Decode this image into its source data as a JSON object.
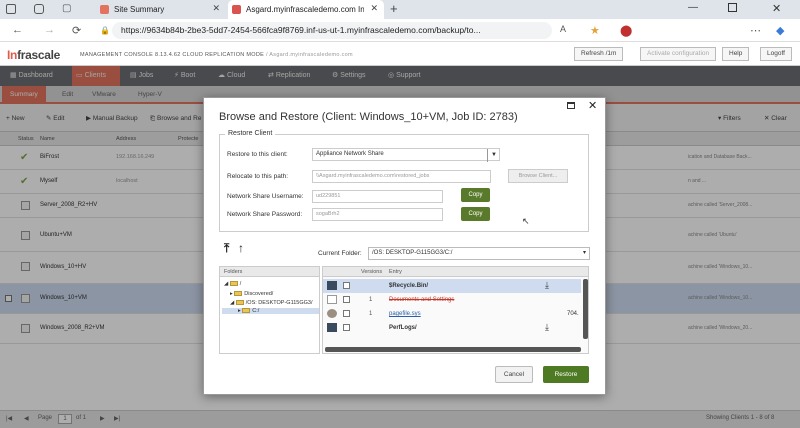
{
  "browser": {
    "tabs": [
      {
        "title": "Site Summary"
      },
      {
        "title": "Asgard.myinfrascalede​mo.com Inf..."
      }
    ],
    "url": "https://9634b84b-2be3-5dd7-2454-566fca9f8769.inf-us-ut-1.myinfrascaledemo.com/backup/to..."
  },
  "app": {
    "logo_prefix": "In",
    "logo_text": "frascale",
    "console_text": "MANAGEMENT CONSOLE 8.13.4.62 CLOUD REPLICATION MODE",
    "site_text": "/ Asgard.myinfrascaledemo.com",
    "header_buttons": {
      "refresh": "Refresh /1m",
      "activate": "Activate configuration",
      "help": "Help",
      "logoff": "Logoff"
    },
    "nav": [
      "Dashboard",
      "Clients",
      "Jobs",
      "Boot",
      "Cloud",
      "Replication",
      "Settings",
      "Support"
    ],
    "subnav": [
      "Summary",
      "Edit",
      "VMware",
      "Hyper-V"
    ],
    "toolbar": {
      "new": "New",
      "edit": "Edit",
      "manual_backup": "Manual Backup",
      "browse_restore": "Browse and Re",
      "filters": "Filters",
      "clear": "Clear"
    },
    "columns": {
      "status": "Status",
      "name": "Name",
      "address": "Address",
      "protected": "Protecte"
    },
    "rows": [
      {
        "name": "BiFrost",
        "address": "192.168.16.249",
        "desc": "ication and Database Back..."
      },
      {
        "name": "Myself",
        "address": "localhost",
        "desc": "n and ..."
      },
      {
        "name": "Server_2008_R2+HV",
        "address": "",
        "desc": "achine called 'Server_2008..."
      },
      {
        "name": "Ubuntu+VM",
        "address": "",
        "desc": "achine called 'Ubuntu'"
      },
      {
        "name": "Windows_10+HV",
        "address": "",
        "desc": "achine called 'Windows_10..."
      },
      {
        "name": "Windows_10+VM",
        "address": "",
        "desc": "achine called 'Windows_10..."
      },
      {
        "name": "Windows_2008_R2+VM",
        "address": "",
        "desc": "achine called 'Windows_20..."
      }
    ],
    "pager": {
      "page_label": "Page",
      "page_value": "1",
      "of_text": "of 1",
      "showing": "Showing Clients 1 - 8 of 8"
    }
  },
  "dialog": {
    "title": "Browse and Restore (Client: Windows_10+VM, Job ID: 2783)",
    "legend": "Restore Client",
    "restore_to_label": "Restore to this client:",
    "restore_to_value": "Appliance Network Share",
    "relocate_label": "Relocate to this path:",
    "relocate_value": "\\\\Asgard.myinfrascaledemo.com\\restored_jobs",
    "browse_client": "Browse Client...",
    "username_label": "Network Share Username:",
    "username_value": "ud229851",
    "password_label": "Network Share Password:",
    "password_value": "sogaBrh2",
    "copy_label": "Copy",
    "current_folder_label": "Current Folder:",
    "current_folder_value": "/OS: DESKTOP-G115GG3/C:/",
    "folders_header": "Folders",
    "tree": [
      "/",
      "Discovered/",
      "/OS: DESKTOP-G115GG3/",
      "C:/"
    ],
    "files_header": {
      "versions": "Versions",
      "entry": "Entry"
    },
    "files": [
      {
        "name": "$Recycle.Bin/",
        "version": ""
      },
      {
        "name": "Documents and Settings",
        "version": "1"
      },
      {
        "name": "pagefile.sys",
        "version": "1",
        "size": "704."
      },
      {
        "name": "PerfLogs/",
        "version": ""
      }
    ],
    "cancel": "Cancel",
    "restore": "Restore"
  }
}
